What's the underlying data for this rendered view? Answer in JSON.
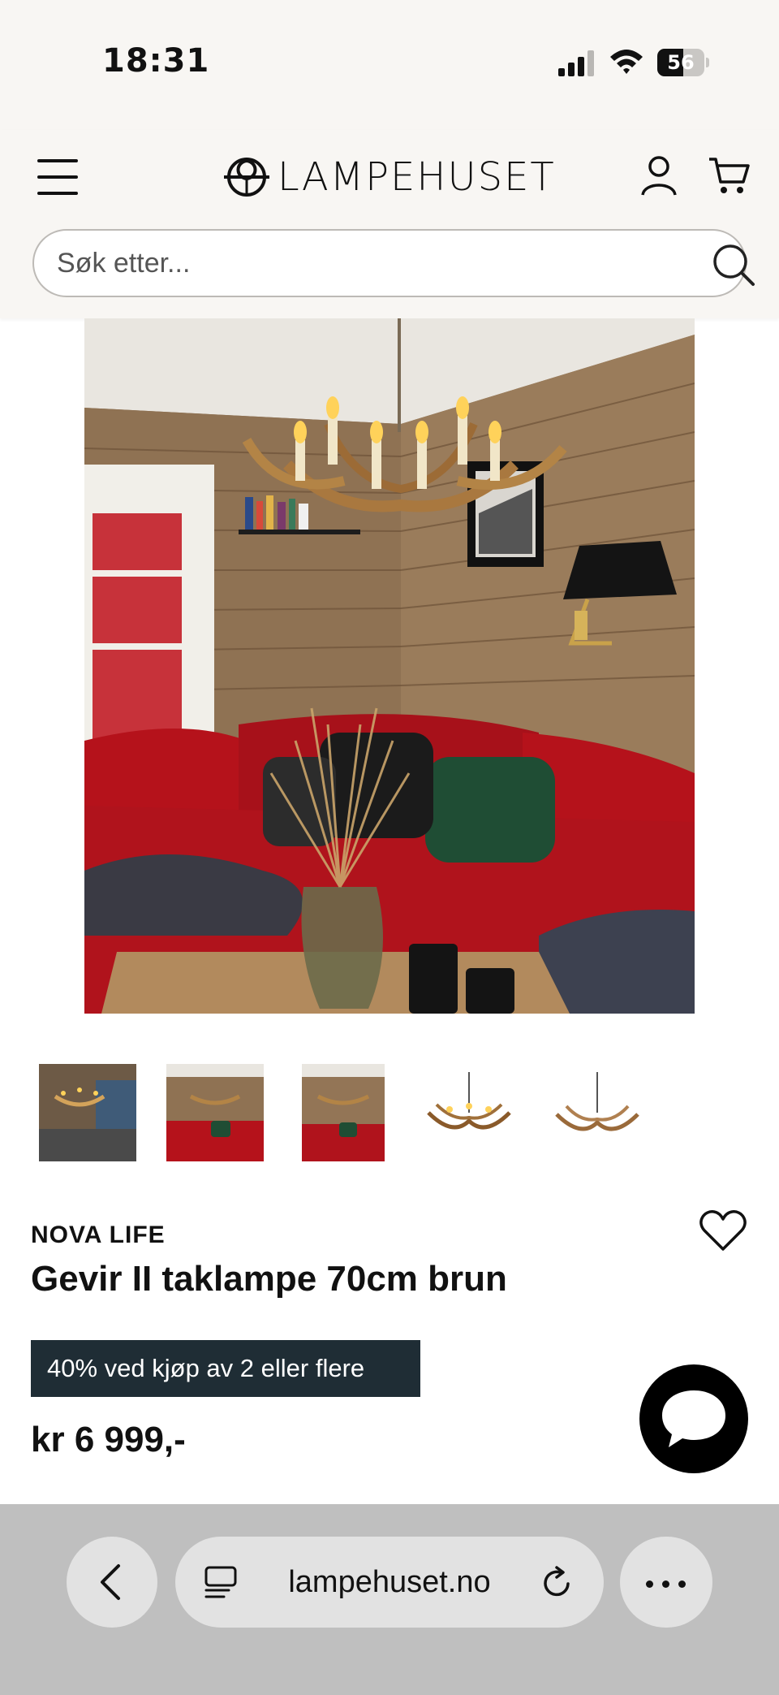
{
  "status_bar": {
    "time": "18:31",
    "battery": "56",
    "battery_level": 0.56
  },
  "header": {
    "brand_name": "LAMPEHUSET",
    "menu_icon": "hamburger-menu-icon",
    "account_icon": "user-icon",
    "cart_icon": "cart-icon",
    "search_placeholder": "Søk etter...",
    "search_icon": "search-icon"
  },
  "gallery": {
    "main_image": "chandelier-living-room-photo",
    "thumbnails": [
      "chandelier-room-window",
      "chandelier-red-sofa",
      "chandelier-red-sofa-2",
      "chandelier-product",
      "chandelier-product-2"
    ]
  },
  "product": {
    "brand": "NOVA LIFE",
    "title": "Gevir II taklampe 70cm brun",
    "promo": "40% ved kjøp av 2 eller flere",
    "price": "kr 6 999,-",
    "favorite_icon": "heart-icon",
    "chat_icon": "chat-bubble-icon"
  },
  "browser": {
    "url": "lampehuset.no",
    "back_icon": "chevron-left-icon",
    "page_icon": "page-menu-icon",
    "reload_icon": "reload-icon",
    "more_icon": "more-dots-icon"
  },
  "colors": {
    "header_bg": "#f8f6f3",
    "promo_bg": "#1f2d35",
    "sofa_red": "#b5121b",
    "toolbar_bg": "#bfbfbf"
  }
}
